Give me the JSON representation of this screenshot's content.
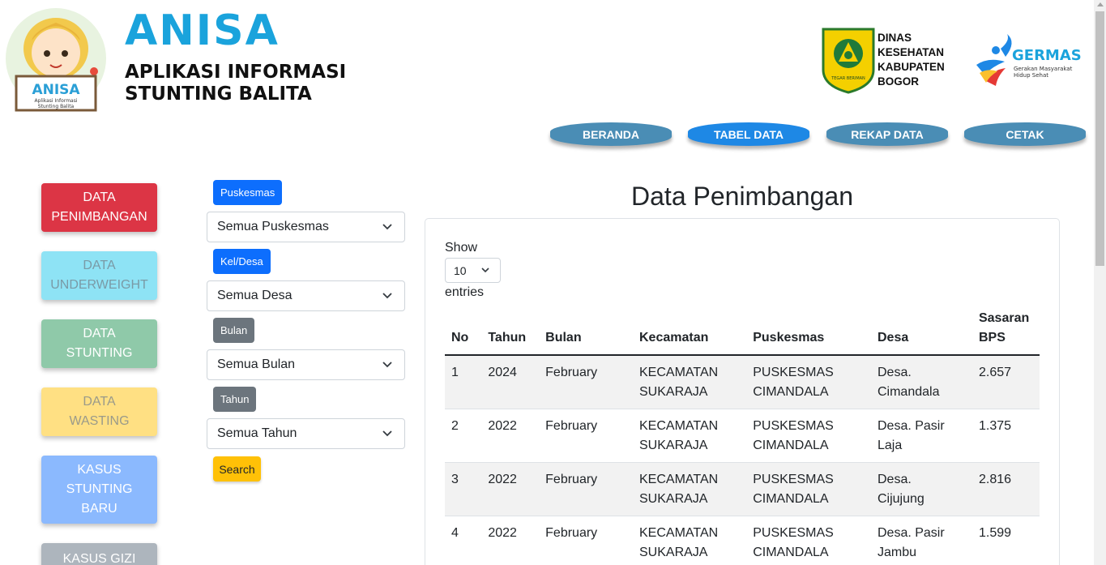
{
  "header": {
    "brand_title": "ANISA",
    "brand_sub_line1": "APLIKASI INFORMASI",
    "brand_sub_line2": "STUNTING BALITA",
    "mascot_sign": "ANISA",
    "mascot_sign_sub1": "Aplikasi Informasi",
    "mascot_sign_sub2": "Stunting Balita",
    "dinas_lines": [
      "DINAS",
      "KESEHATAN",
      "KABUPATEN",
      "BOGOR"
    ],
    "dinas_emblem_text": "TEGAR BERIMAN",
    "germas_title": "GERMAS",
    "germas_sub1": "Gerakan Masyarakat",
    "germas_sub2": "Hidup Sehat"
  },
  "nav": {
    "items": [
      {
        "label": "BERANDA",
        "active": false
      },
      {
        "label": "TABEL DATA",
        "active": true
      },
      {
        "label": "REKAP DATA",
        "active": false
      },
      {
        "label": "CETAK",
        "active": false
      }
    ]
  },
  "sidebar": {
    "items": [
      {
        "line1": "DATA",
        "line2": "PENIMBANGAN",
        "bg": "#dc3545",
        "fg": "#ffffff"
      },
      {
        "line1": "DATA",
        "line2": "UNDERWEIGHT",
        "bg": "#8ee3f5",
        "fg": "#7a9aa6"
      },
      {
        "line1": "DATA",
        "line2": "STUNTING",
        "bg": "#8fc9a9",
        "fg": "#ffffff"
      },
      {
        "line1": "DATA",
        "line2": "WASTING",
        "bg": "#ffe083",
        "fg": "#9a9a8a"
      },
      {
        "line1": "KASUS",
        "line2": "STUNTING",
        "line3": "BARU",
        "bg": "#8bb9fe",
        "fg": "#ffffff"
      },
      {
        "line1": "KASUS GIZI",
        "bg": "#adb5bd",
        "fg": "#ffffff"
      }
    ]
  },
  "filters": {
    "puskesmas_label": "Puskesmas",
    "puskesmas_value": "Semua Puskesmas",
    "desa_label": "Kel/Desa",
    "desa_value": "Semua Desa",
    "bulan_label": "Bulan",
    "bulan_value": "Semua Bulan",
    "tahun_label": "Tahun",
    "tahun_value": "Semua Tahun",
    "search_label": "Search"
  },
  "main": {
    "title": "Data Penimbangan",
    "show_label": "Show",
    "entries_value": "10",
    "entries_label": "entries",
    "columns": [
      "No",
      "Tahun",
      "Bulan",
      "Kecamatan",
      "Puskesmas",
      "Desa",
      "Sasaran BPS"
    ],
    "rows": [
      [
        "1",
        "2024",
        "February",
        "KECAMATAN SUKARAJA",
        "PUSKESMAS CIMANDALA",
        "Desa. Cimandala",
        "2.657"
      ],
      [
        "2",
        "2022",
        "February",
        "KECAMATAN SUKARAJA",
        "PUSKESMAS CIMANDALA",
        "Desa. Pasir Laja",
        "1.375"
      ],
      [
        "3",
        "2022",
        "February",
        "KECAMATAN SUKARAJA",
        "PUSKESMAS CIMANDALA",
        "Desa. Cijujung",
        "2.816"
      ],
      [
        "4",
        "2022",
        "February",
        "KECAMATAN SUKARAJA",
        "PUSKESMAS CIMANDALA",
        "Desa. Pasir Jambu",
        "1.599"
      ]
    ]
  },
  "colors": {
    "brand": "#1aa3dc",
    "nav_default": "#4a8db5",
    "nav_active": "#1e88e5",
    "badge_primary": "#0d6efd",
    "badge_secondary": "#6c757d",
    "search": "#ffc107"
  }
}
